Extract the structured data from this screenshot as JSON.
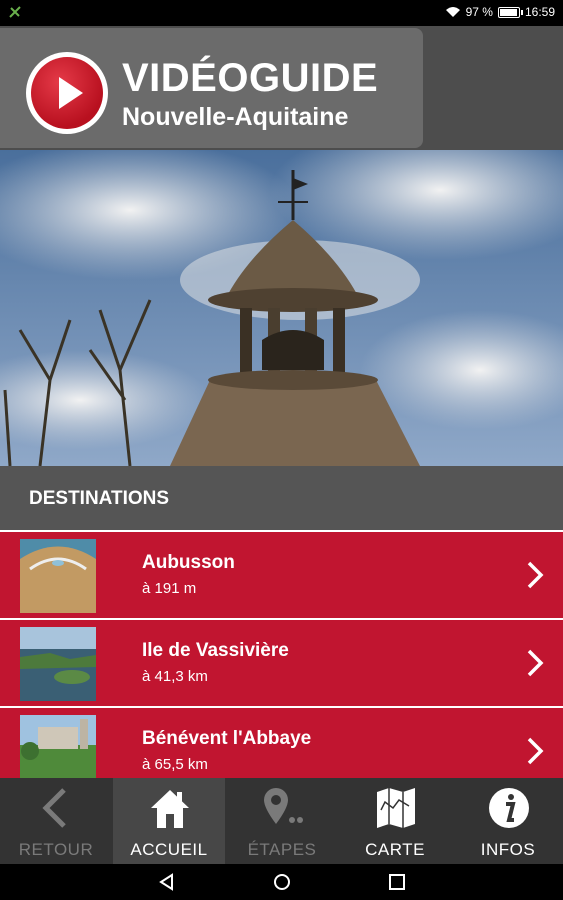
{
  "status_bar": {
    "battery_percent_text": "97 %",
    "time": "16:59",
    "battery_level": 0.97
  },
  "header": {
    "title": "VIDÉOGUIDE",
    "subtitle": "Nouvelle-Aquitaine"
  },
  "destinations": {
    "heading": "DESTINATIONS",
    "items": [
      {
        "name": "Aubusson",
        "distance": "à 191 m"
      },
      {
        "name": "Ile de Vassivière",
        "distance": "à 41,3 km"
      },
      {
        "name": "Bénévent l'Abbaye",
        "distance": "à 65,5 km"
      }
    ]
  },
  "bottom_nav": {
    "back": "RETOUR",
    "home": "ACCUEIL",
    "steps": "ÉTAPES",
    "map": "CARTE",
    "info": "INFOS"
  },
  "colors": {
    "accent_red": "#c11530",
    "header_grey": "#6b6b6b",
    "nav_dark": "#333333"
  },
  "icons": {
    "play": "play-icon",
    "chevron": "chevron-right-icon",
    "back": "chevron-left-icon",
    "home": "house-icon",
    "steps": "map-pin-icon",
    "map": "folded-map-icon",
    "info": "info-icon"
  }
}
